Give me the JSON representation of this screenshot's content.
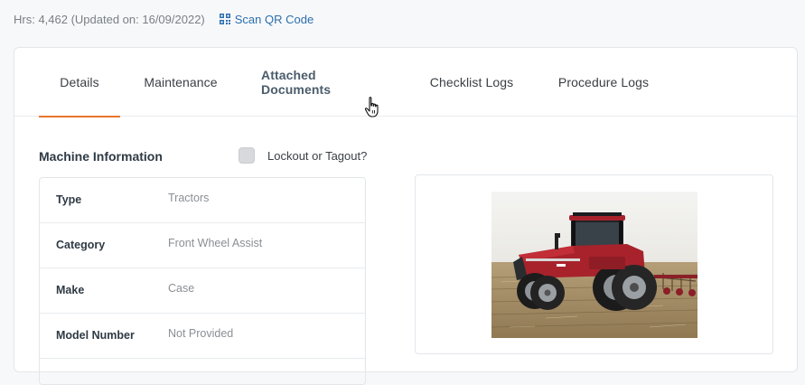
{
  "header": {
    "hours_text": "Hrs: 4,462 (Updated on: 16/09/2022)",
    "qr_label": "Scan QR Code"
  },
  "tabs": [
    {
      "label": "Details",
      "active": true
    },
    {
      "label": "Maintenance",
      "active": false
    },
    {
      "label": "Attached Documents",
      "active": false,
      "hovered": true
    },
    {
      "label": "Checklist Logs",
      "active": false
    },
    {
      "label": "Procedure Logs",
      "active": false
    }
  ],
  "machine_info": {
    "title": "Machine Information",
    "lockout_label": "Lockout or Tagout?",
    "lockout_checked": false,
    "rows": [
      {
        "label": "Type",
        "value": "Tractors"
      },
      {
        "label": "Category",
        "value": "Front Wheel Assist"
      },
      {
        "label": "Make",
        "value": "Case"
      },
      {
        "label": "Model Number",
        "value": "Not Provided"
      }
    ]
  },
  "colors": {
    "accent": "#e8762d",
    "link": "#2c6fae",
    "tractor_red": "#a8222c"
  }
}
